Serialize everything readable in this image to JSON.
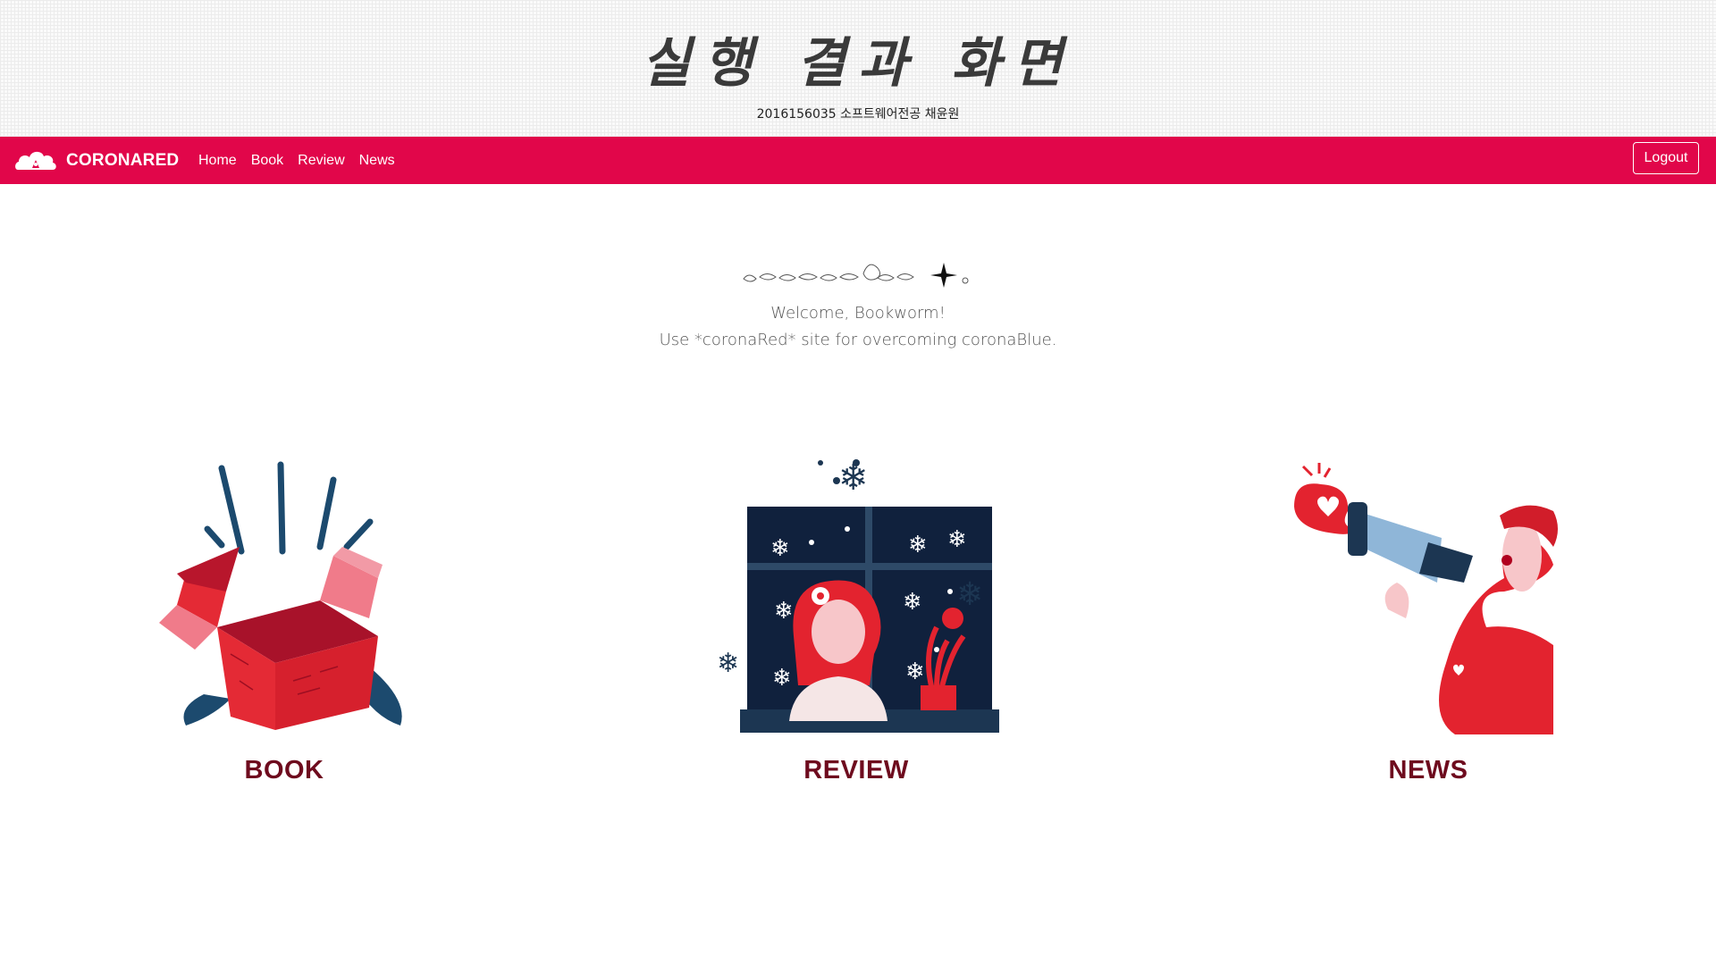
{
  "banner": {
    "title": "실행 결과 화면",
    "subtitle": "2016156035 소프트웨어전공 채윤원"
  },
  "navbar": {
    "brand": "CORONARED",
    "links": [
      "Home",
      "Book",
      "Review",
      "News"
    ],
    "logout_label": "Logout",
    "background_color": "#e1064a"
  },
  "hero": {
    "line1": "Welcome, Bookworm!",
    "line2": "Use *coronaRed* site for overcoming coronaBlue."
  },
  "cards": [
    {
      "label": "BOOK",
      "illustration": "open-gift-box-illustration"
    },
    {
      "label": "REVIEW",
      "illustration": "girl-at-snowy-window-illustration"
    },
    {
      "label": "NEWS",
      "illustration": "woman-with-megaphone-illustration"
    }
  ],
  "colors": {
    "accent_red": "#e1064a",
    "label_dark_red": "#6e0b1e",
    "navy": "#1c4a6e"
  }
}
